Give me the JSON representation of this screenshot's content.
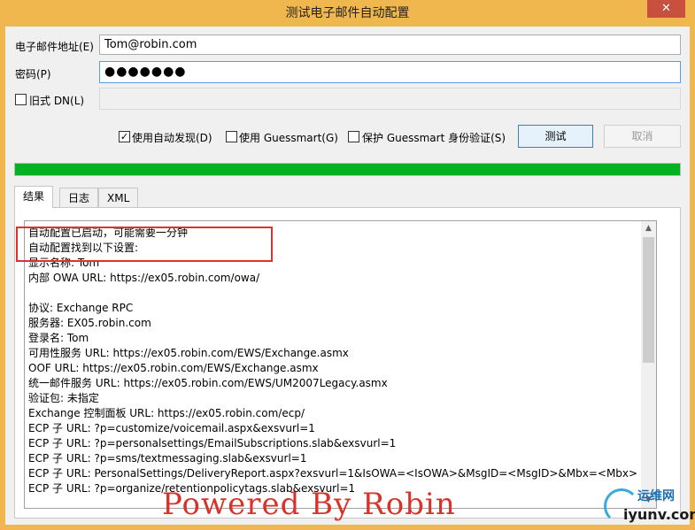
{
  "window": {
    "title": "测试电子邮件自动配置",
    "close_glyph": "✕"
  },
  "form": {
    "email_label": "电子邮件地址(E)",
    "email_value": "Tom@robin.com",
    "password_label": "密码(P)",
    "password_value": "●●●●●●●",
    "legacy_dn_label": "旧式 DN(L)",
    "legacy_dn_checked": false,
    "legacy_dn_value": ""
  },
  "options": {
    "autodiscover_label": "使用自动发现(D)",
    "autodiscover_checked": true,
    "autodiscover_check_glyph": "✓",
    "guessmart_label": "使用 Guessmart(G)",
    "guessmart_checked": false,
    "secure_guessmart_label": "保护 Guessmart 身份验证(S)",
    "secure_guessmart_checked": false
  },
  "buttons": {
    "test_label": "测试",
    "cancel_label": "取消"
  },
  "progress": {
    "value": 1.0,
    "color": "#06b025"
  },
  "tabs": [
    {
      "label": "结果",
      "active": true
    },
    {
      "label": "日志",
      "active": false
    },
    {
      "label": "XML",
      "active": false
    }
  ],
  "results": {
    "lines": [
      "自动配置已启动，可能需要一分钟",
      "自动配置找到以下设置:",
      "显示名称: Tom",
      "内部 OWA URL: https://ex05.robin.com/owa/",
      "",
      "协议: Exchange RPC",
      "服务器: EX05.robin.com",
      "登录名: Tom",
      "可用性服务 URL: https://ex05.robin.com/EWS/Exchange.asmx",
      "OOF URL: https://ex05.robin.com/EWS/Exchange.asmx",
      "统一邮件服务 URL: https://ex05.robin.com/EWS/UM2007Legacy.asmx",
      "验证包: 未指定",
      "Exchange 控制面板 URL: https://ex05.robin.com/ecp/",
      "ECP 子 URL: ?p=customize/voicemail.aspx&exsvurl=1",
      "ECP 子 URL: ?p=personalsettings/EmailSubscriptions.slab&exsvurl=1",
      "ECP 子 URL: ?p=sms/textmessaging.slab&exsvurl=1",
      "ECP 子 URL: PersonalSettings/DeliveryReport.aspx?exsvurl=1&IsOWA=<IsOWA>&MsgID=<MsgID>&Mbx=<Mbx>",
      "ECP 子 URL: ?p=organize/retentionpolicytags.slab&exsvurl=1"
    ],
    "scroll_up_glyph": "▲",
    "scroll_down_glyph": "▼"
  },
  "watermark": {
    "text": "Powered By Robin",
    "color": "#d8322a"
  },
  "site_logo": {
    "cn_text": "运维网",
    "domain_text": "iyunv.com"
  },
  "colors": {
    "title_bar": "#f0b74e",
    "highlight_box": "#e0312e",
    "accent": "#3c7fb1"
  }
}
